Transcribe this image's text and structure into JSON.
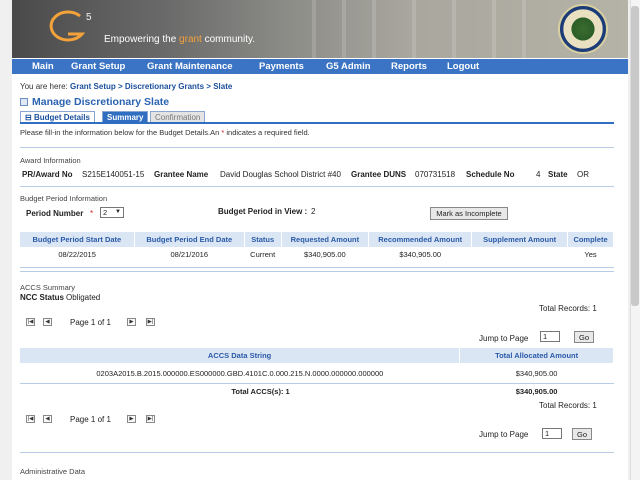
{
  "header": {
    "logo_text": "G5",
    "tagline_pre": "Empowering the ",
    "tagline_grant": "grant",
    "tagline_post": " community.",
    "seal_alt": "Department of Education seal"
  },
  "nav": [
    "Main",
    "Grant Setup",
    "Grant Maintenance",
    "Payments",
    "G5 Admin",
    "Reports",
    "Logout"
  ],
  "breadcrumb": {
    "prefix": "You are here:",
    "items": [
      "Grant Setup",
      ">",
      "Discretionary Grants",
      ">",
      "Slate"
    ]
  },
  "page_title": "Manage Discretionary Slate",
  "tabs": [
    "Budget Details",
    "Summary",
    "Confirmation"
  ],
  "instructions": {
    "pre": "Please fill-in the information below for the Budget Details.An ",
    "star": "*",
    "post": " indicates a required field."
  },
  "award": {
    "section": "Award Information",
    "pr_label": "PR/Award No",
    "pr_value": "S215E140051-15",
    "grantee_label": "Grantee Name",
    "grantee_value": "David Douglas School District #40",
    "duns_label": "Grantee DUNS",
    "duns_value": "070731518",
    "schedule_label": "Schedule No",
    "schedule_value": "4",
    "state_label": "State",
    "state_value": "OR"
  },
  "budget": {
    "section": "Budget Period Information",
    "period_label": "Period Number",
    "star": "*",
    "period_value": "2",
    "in_view_label": "Budget Period in View :",
    "in_view_value": "2",
    "incomplete_button": "Mark as Incomplete",
    "columns": [
      "Budget Period Start Date",
      "Budget Period End Date",
      "Status",
      "Requested Amount",
      "Recommended Amount",
      "Supplement Amount",
      "Complete"
    ],
    "rows": [
      [
        "08/22/2015",
        "08/21/2016",
        "Current",
        "$340,905.00",
        "$340,905.00",
        "",
        "Yes"
      ]
    ]
  },
  "accs": {
    "section": "ACCS Summary",
    "ncc_label": "NCC Status",
    "ncc_value": "Obligated",
    "total_records": "Total Records: 1",
    "page_info": "Page 1 of 1",
    "jump_label": "Jump to Page",
    "jump_value": "1",
    "go_label": "Go",
    "columns": [
      "ACCS Data String",
      "Total Allocated Amount"
    ],
    "rows": [
      [
        "0203A2015.B.2015.000000.ES000000.GBD.4101C.0.000.215.N.0000.000000.000000",
        "$340,905.00"
      ]
    ],
    "total_label": "Total ACCS(s): 1",
    "total_value": "$340,905.00"
  },
  "admin": {
    "section": "Administrative Data"
  }
}
